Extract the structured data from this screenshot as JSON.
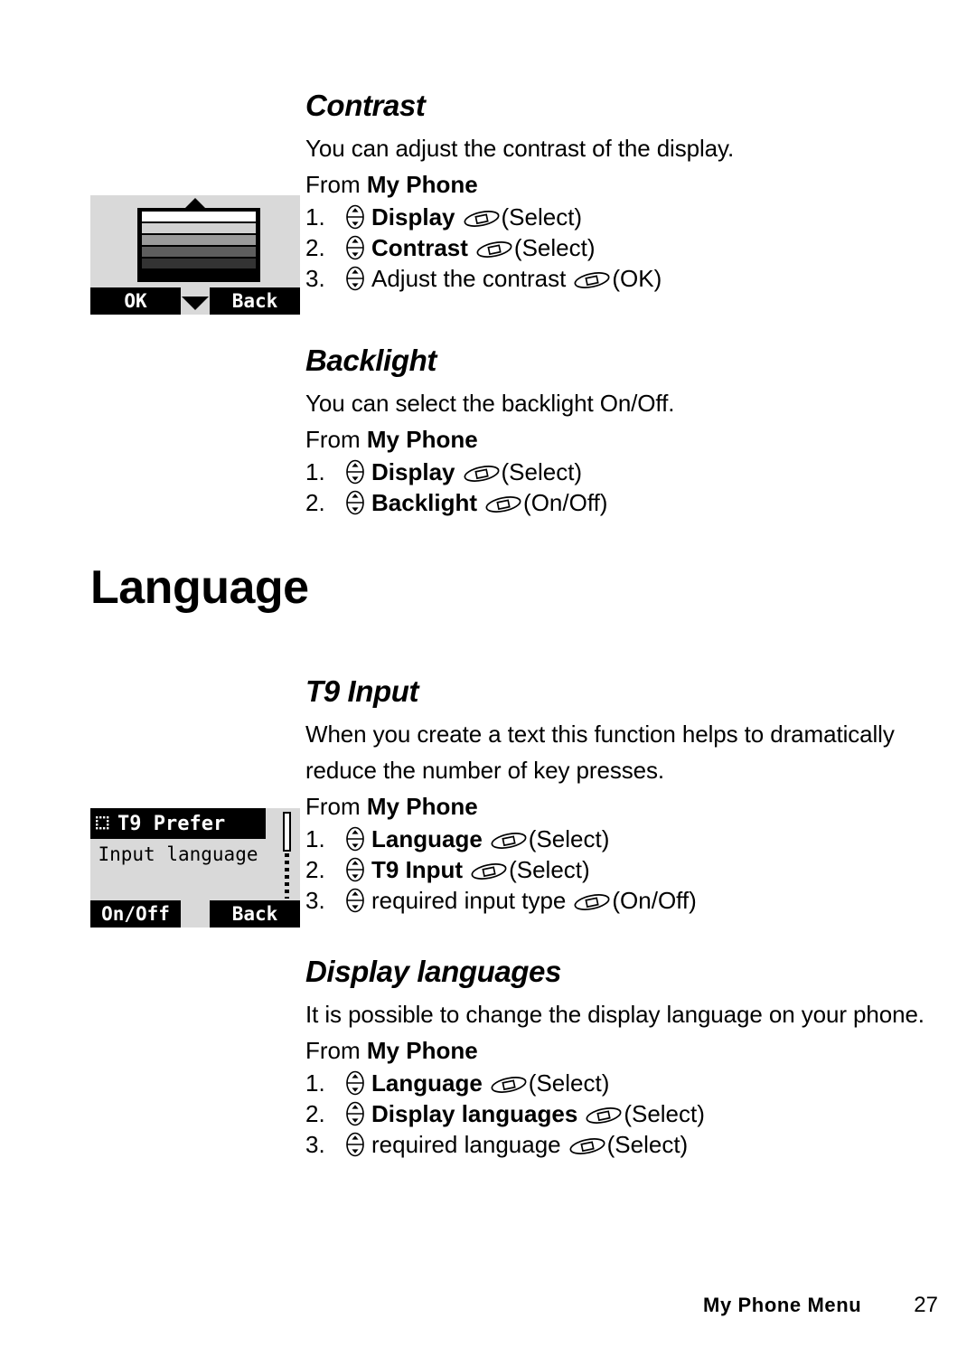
{
  "page": {
    "footer_label": "My Phone Menu",
    "page_number": "27"
  },
  "headings": {
    "language": "Language"
  },
  "sections": [
    {
      "title": "Contrast",
      "body": [
        "You can adjust the contrast of the display."
      ],
      "from_prefix": "From ",
      "from_target": "My Phone",
      "steps": [
        {
          "num": "1.",
          "label": "Display",
          "bold": true,
          "suffix": "(Select)"
        },
        {
          "num": "2.",
          "label": "Contrast",
          "bold": true,
          "suffix": "(Select)"
        },
        {
          "num": "3.",
          "label": "Adjust the contrast",
          "bold": false,
          "suffix": "(OK)"
        }
      ]
    },
    {
      "title": "Backlight",
      "body": [
        "You can select the backlight On/Off."
      ],
      "from_prefix": "From ",
      "from_target": "My Phone",
      "steps": [
        {
          "num": "1.",
          "label": "Display",
          "bold": true,
          "suffix": "(Select)"
        },
        {
          "num": "2.",
          "label": "Backlight",
          "bold": true,
          "suffix": "(On/Off)"
        }
      ]
    },
    {
      "title": "T9 Input",
      "body": [
        "When you create a text this function helps to dramatically",
        "reduce the number of key presses."
      ],
      "from_prefix": "From ",
      "from_target": "My Phone",
      "steps": [
        {
          "num": "1.",
          "label": "Language",
          "bold": true,
          "suffix": "(Select)"
        },
        {
          "num": "2.",
          "label": "T9 Input",
          "bold": true,
          "suffix": "(Select)"
        },
        {
          "num": "3.",
          "label": "required input type",
          "bold": false,
          "suffix": "(On/Off)"
        }
      ]
    },
    {
      "title": "Display languages",
      "body": [
        "It is possible to change the display language on your phone."
      ],
      "from_prefix": "From ",
      "from_target": "My Phone",
      "steps": [
        {
          "num": "1.",
          "label": "Language",
          "bold": true,
          "suffix": "(Select)"
        },
        {
          "num": "2.",
          "label": "Display languages",
          "bold": true,
          "suffix": "(Select)"
        },
        {
          "num": "3.",
          "label": "required language",
          "bold": false,
          "suffix": "(Select)"
        }
      ]
    }
  ],
  "illustrations": {
    "contrast_screen": {
      "softkey_left": "OK",
      "softkey_right": "Back",
      "gradient_shades": [
        "#ffffff",
        "#d2d2d2",
        "#9b9b9b",
        "#5e5e5e",
        "#333333"
      ],
      "background": "#d9d9d9"
    },
    "t9_screen": {
      "title": "T9 Prefer",
      "list_item": "Input language",
      "softkey_left": "On/Off",
      "softkey_right": "Back",
      "background": "#d9d9d9"
    }
  },
  "icons": {
    "nav_key": "navigation-key-icon",
    "soft_key": "soft-key-icon"
  }
}
